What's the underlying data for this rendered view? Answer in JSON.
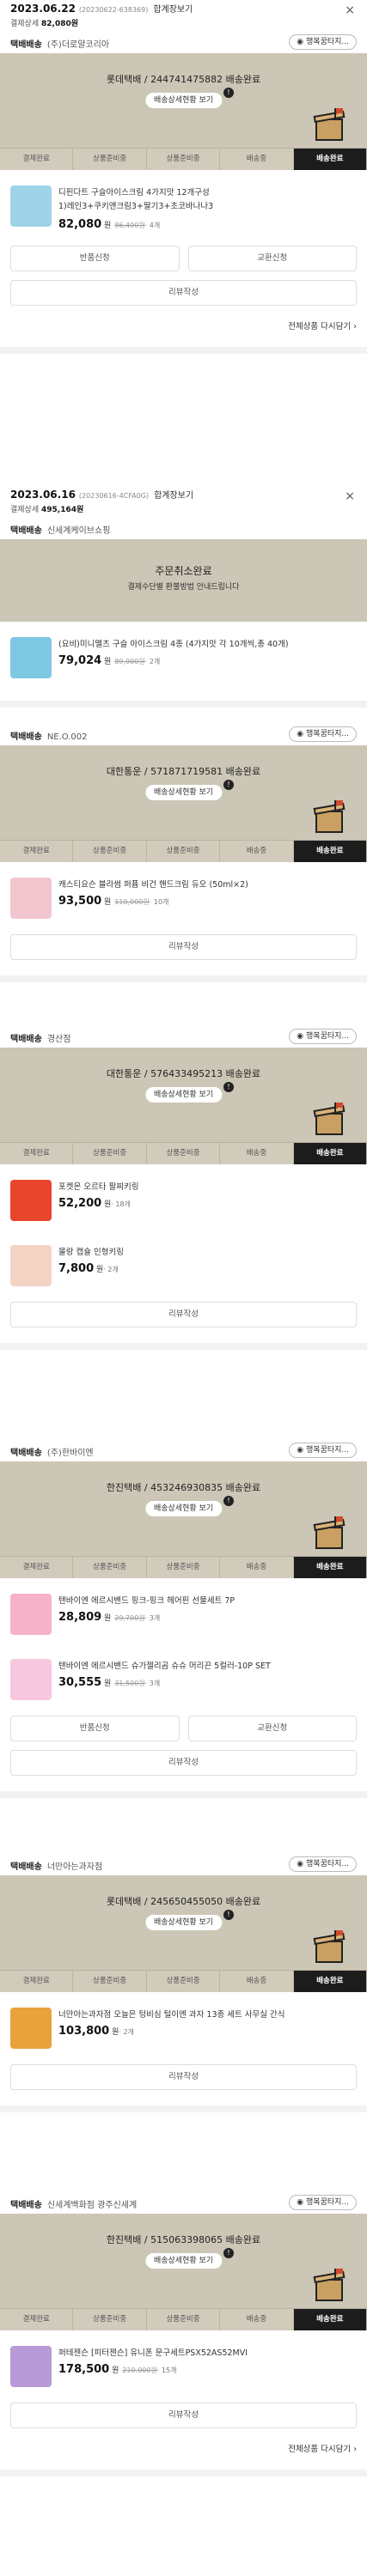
{
  "icons": {
    "close": "×",
    "chevron": "›",
    "notice": "!"
  },
  "orders": [
    {
      "date": "2023.06.22",
      "number": "(20230622-638369)",
      "link": "합계장보기",
      "total_label": "결제상세",
      "total": "82,080원",
      "shipments": [
        {
          "label": "택배배송",
          "seller": "(주)더로얄코리아",
          "button": "행복꿈타지...",
          "tracking": "롯데택배 / 244741475882 배송완료",
          "track_button": "배송상세현황 보기",
          "steps": [
            "결제완료",
            "상품준비중",
            "상품준비중",
            "배송중",
            "배송완료"
          ],
          "items": [
            {
              "name": "디핀다트 구슬아이스크림 4가지맛 12개구성",
              "option": "1)레인3+쿠키앤크림3+딸기3+초코바나나3",
              "price": "82,080",
              "won": "원",
              "orig": "86,400원",
              "qty": "· 4개",
              "thumb": "#9fd3e8"
            }
          ],
          "buttons": [
            "반품신청",
            "교환신청",
            "리뷰작성"
          ],
          "more": "전체상품 다시담기"
        }
      ]
    },
    {
      "date": "2023.06.16",
      "number": "(20230616-4CFA0G)",
      "link": "합계장보기",
      "total_label": "결제상세",
      "total": "495,164원",
      "shipments": [
        {
          "label": "택배배송",
          "seller": "신세계케이브쇼핑",
          "cancel_title": "주문취소완료",
          "cancel_desc": "결제수단별 환불방법 안내드립니다",
          "items": [
            {
              "name": "(요비)미니멜츠 구슬 아이스크림 4종 (4가지맛 각 10개씩,총 40개)",
              "option": "",
              "price": "79,024",
              "won": "원",
              "orig": "89,000원",
              "qty": "· 2개",
              "thumb": "#7ec8e3"
            }
          ]
        },
        {
          "label": "택배배송",
          "seller": "NE.O.002",
          "button": "행복꿈타지...",
          "tracking": "대한통운 / 571871719581 배송완료",
          "track_button": "배송상세현황 보기",
          "steps": [
            "결제완료",
            "상품준비중",
            "상품준비중",
            "배송중",
            "배송완료"
          ],
          "items": [
            {
              "name": "캐스티요슨 블라썸 퍼퓸 비건 핸드크림 듀오 (50ml×2)",
              "option": "",
              "price": "93,500",
              "won": "원",
              "orig": "110,000원",
              "qty": "· 10개",
              "thumb": "#f2c6cf"
            }
          ],
          "buttons": [
            "리뷰작성"
          ]
        },
        {
          "label": "택배배송",
          "seller": "경산점",
          "button": "행복꿈타지...",
          "tracking": "대한통운 / 576433495213 배송완료",
          "track_button": "배송상세현황 보기",
          "steps": [
            "결제완료",
            "상품준비중",
            "상품준비중",
            "배송중",
            "배송완료"
          ],
          "items": [
            {
              "name": "포켓몬 오르타 팔찌키링",
              "option": "",
              "price": "52,200",
              "won": "원",
              "orig": "",
              "qty": "· 18개",
              "thumb": "#e8452c"
            },
            {
              "name": "몰랑 캡슐 인형키링",
              "option": "",
              "price": "7,800",
              "won": "원",
              "orig": "",
              "qty": "· 2개",
              "thumb": "#f4d2c4"
            }
          ],
          "buttons": [
            "리뷰작성"
          ]
        },
        {
          "label": "택배배송",
          "seller": "(주)한바이엔",
          "button": "행복꿈타지...",
          "tracking": "한진택배 / 453246930835 배송완료",
          "track_button": "배송상세현황 보기",
          "steps": [
            "결제완료",
            "상품준비중",
            "상품준비중",
            "배송중",
            "배송완료"
          ],
          "items": [
            {
              "name": "탠바이엔 에르시밴드 핑크-핑크 헤어핀 선물세트 7P",
              "option": "",
              "price": "28,809",
              "won": "원",
              "orig": "29,700원",
              "qty": "· 3개",
              "thumb": "#f5b2c8"
            },
            {
              "name": "탠바이엔 에르시밴드 슈가젤리곰 슈슈 머리끈 5컬러-10P SET",
              "option": "",
              "price": "30,555",
              "won": "원",
              "orig": "31,500원",
              "qty": "· 3개",
              "thumb": "#f7c7e0"
            }
          ],
          "buttons": [
            "반품신청",
            "교환신청",
            "리뷰작성"
          ]
        },
        {
          "label": "택배배송",
          "seller": "너만아는과자점",
          "button": "행복꿈타지...",
          "tracking": "롯데택배 / 245650455050 배송완료",
          "track_button": "배송상세현황 보기",
          "steps": [
            "결제완료",
            "상품준비중",
            "상품준비중",
            "배송중",
            "배송완료"
          ],
          "items": [
            {
              "name": "너만아는과자점 오늘은 텅비심 털이엔 과자 13종 세트 사무실 간식",
              "option": "",
              "price": "103,800",
              "won": "원",
              "orig": "",
              "qty": "· 2개",
              "thumb": "#e8a23a"
            }
          ],
          "buttons": [
            "리뷰작성"
          ]
        },
        {
          "label": "택배배송",
          "seller": "신세계백화점 광주신세계",
          "button": "행복꿈타지...",
          "tracking": "한진택배 / 515063398065 배송완료",
          "track_button": "배송상세현황 보기",
          "steps": [
            "결제완료",
            "상품준비중",
            "상품준비중",
            "배송중",
            "배송완료"
          ],
          "items": [
            {
              "name": "퍼테젠슨 [피터젠슨] 유니폰 문구세트PSX52AS52MVI",
              "option": "",
              "price": "178,500",
              "won": "원",
              "orig": "210,000원",
              "qty": "· 15개",
              "thumb": "#b79ad6"
            }
          ],
          "buttons": [
            "리뷰작성"
          ],
          "more": "전체상품 다시담기"
        }
      ]
    }
  ]
}
